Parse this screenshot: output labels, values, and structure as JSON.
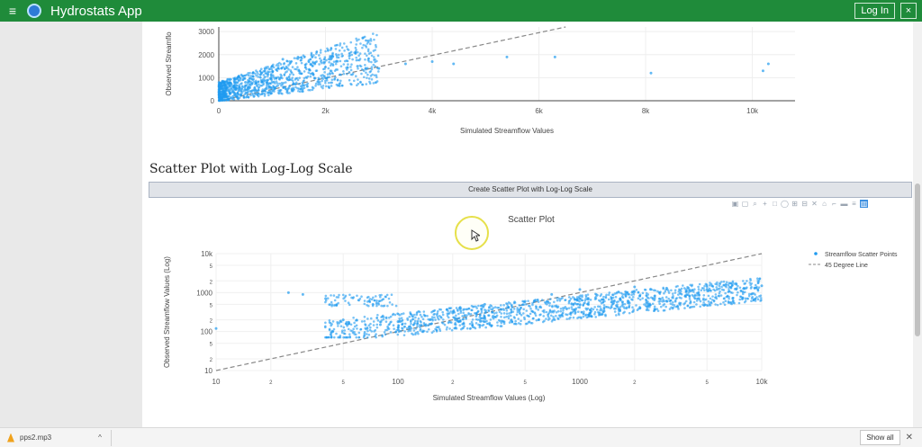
{
  "header": {
    "menu_icon": "hamburger-icon",
    "app_title": "Hydrostats App",
    "login_label": "Log In",
    "close_label": "×"
  },
  "section": {
    "title": "Scatter Plot with Log-Log Scale",
    "button_label": "Create Scatter Plot with Log-Log Scale"
  },
  "modebar_icons": [
    "camera-icon",
    "save-icon",
    "zoom-icon",
    "pan-icon",
    "box-select-icon",
    "lasso-icon",
    "zoom-in-icon",
    "zoom-out-icon",
    "autoscale-icon",
    "reset-axes-icon",
    "spike-icon",
    "hover-closest-icon",
    "hover-compare-icon",
    "plotly-logo-icon"
  ],
  "colors": {
    "accent": "#1f8b3a",
    "series": "#1f9bf0",
    "line": "#888888"
  },
  "chart_data": [
    {
      "type": "scatter",
      "title": "",
      "xlabel": "Simulated Streamflow Values",
      "ylabel": "Observed Streamflo",
      "xlim": [
        0,
        10800
      ],
      "ylim": [
        0,
        3200
      ],
      "xticks": [
        "0",
        "2k",
        "4k",
        "6k",
        "8k",
        "10k"
      ],
      "yticks": [
        "0",
        "1000",
        "2000",
        "3000"
      ],
      "series": [
        {
          "name": "",
          "points": [
            [
              200,
              400
            ],
            [
              500,
              800
            ],
            [
              800,
              1200
            ],
            [
              1000,
              1500
            ],
            [
              1200,
              1800
            ],
            [
              1500,
              1300
            ],
            [
              1800,
              1600
            ],
            [
              2200,
              1700
            ],
            [
              2600,
              1500
            ],
            [
              3000,
              1400
            ],
            [
              3500,
              1600
            ],
            [
              4000,
              1700
            ],
            [
              4400,
              1600
            ],
            [
              5400,
              1900
            ],
            [
              6300,
              1900
            ],
            [
              8100,
              1200
            ],
            [
              10300,
              1600
            ],
            [
              10200,
              1300
            ]
          ]
        },
        {
          "name": "",
          "line": [
            [
              0,
              0
            ],
            [
              6500,
              3200
            ]
          ]
        }
      ]
    },
    {
      "type": "scatter",
      "title": "Scatter Plot",
      "xlabel": "Simulated Streamflow Values (Log)",
      "ylabel": "Observed Streamflow Values (Log)",
      "x_scale": "log",
      "y_scale": "log",
      "xticks": [
        "10",
        "2",
        "5",
        "100",
        "2",
        "5",
        "1000",
        "2",
        "5",
        "10k"
      ],
      "yticks": [
        "10",
        "2",
        "5",
        "100",
        "2",
        "5",
        "1000",
        "2",
        "5",
        "10k"
      ],
      "legend": "top-right",
      "series": [
        {
          "name": "Streamflow Scatter Points",
          "points": [
            [
              10,
              120
            ],
            [
              25,
              1000
            ],
            [
              30,
              900
            ],
            [
              40,
              700
            ],
            [
              50,
              200
            ],
            [
              80,
              150
            ],
            [
              100,
              180
            ],
            [
              150,
              200
            ],
            [
              200,
              300
            ],
            [
              300,
              500
            ],
            [
              500,
              600
            ],
            [
              700,
              900
            ],
            [
              1000,
              1200
            ],
            [
              2000,
              1400
            ],
            [
              3000,
              1300
            ],
            [
              5000,
              1200
            ],
            [
              8000,
              1300
            ],
            [
              10000,
              1500
            ]
          ]
        },
        {
          "name": "45 Degree Line",
          "line": [
            [
              10,
              10
            ],
            [
              10000,
              10000
            ]
          ]
        }
      ]
    }
  ],
  "cursor_icon": "mouse-pointer-icon",
  "download": {
    "file_icon": "vlc-cone-icon",
    "file_name": "pps2.mp3",
    "chevron": "^",
    "show_all_label": "Show all",
    "close_label": "✕"
  }
}
